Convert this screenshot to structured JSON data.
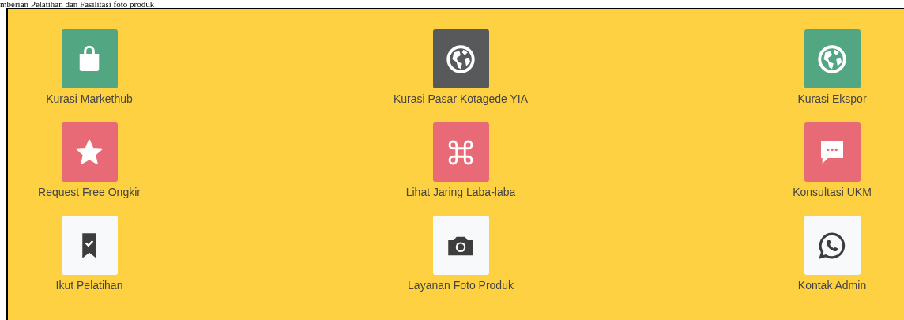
{
  "heading": "mberian Pelatihan dan Fasilitasi foto produk",
  "menu": [
    {
      "label": "Kurasi Markethub",
      "color": "#52a782"
    },
    {
      "label": "Kurasi Pasar Kotagede YIA",
      "color": "#58595b"
    },
    {
      "label": "Kurasi Ekspor",
      "color": "#52a782"
    },
    {
      "label": "Request Free Ongkir",
      "color": "#e76a76"
    },
    {
      "label": "Lihat Jaring Laba-laba",
      "color": "#e76a76"
    },
    {
      "label": "Konsultasi UKM",
      "color": "#e76a76"
    },
    {
      "label": "Ikut Pelatihan",
      "color": "#f8f9fa"
    },
    {
      "label": "Layanan Foto Produk",
      "color": "#f8f9fa"
    },
    {
      "label": "Kontak Admin",
      "color": "#f8f9fa"
    }
  ]
}
